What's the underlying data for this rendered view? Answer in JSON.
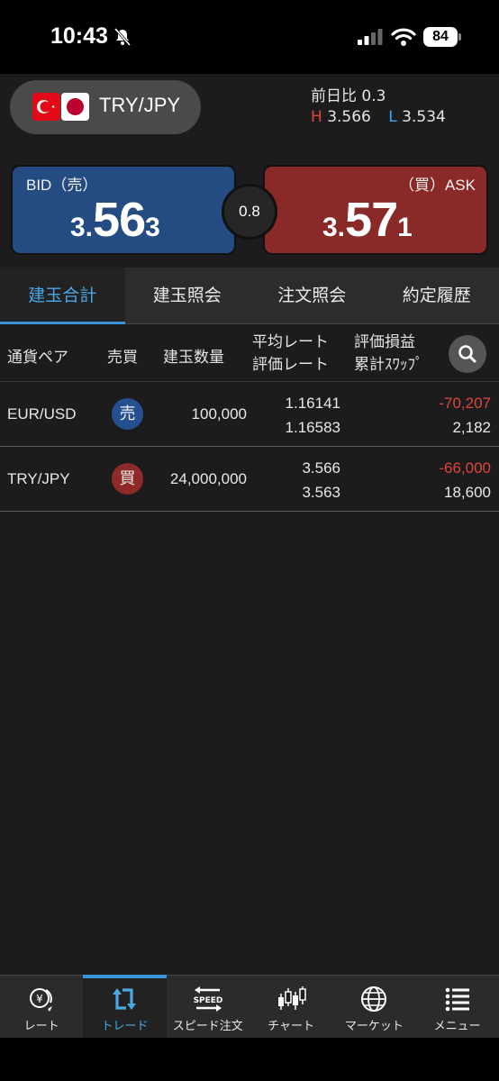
{
  "status_bar": {
    "time": "10:43",
    "battery": "84"
  },
  "header": {
    "pair": "TRY/JPY",
    "prev_day_label": "前日比",
    "prev_day_value": "0.3",
    "high_letter": "H",
    "high_value": "3.566",
    "low_letter": "L",
    "low_value": "3.534"
  },
  "quote": {
    "bid_label": "BID（売）",
    "bid_prefix": "3.",
    "bid_main": "56",
    "bid_suffix": "3",
    "ask_label": "（買）ASK",
    "ask_prefix": "3.",
    "ask_main": "57",
    "ask_suffix": "1",
    "spread": "0.8"
  },
  "tabs": [
    {
      "label": "建玉合計",
      "active": true
    },
    {
      "label": "建玉照会",
      "active": false
    },
    {
      "label": "注文照会",
      "active": false
    },
    {
      "label": "約定履歴",
      "active": false
    }
  ],
  "table": {
    "headers": {
      "pair": "通貨ペア",
      "side": "売買",
      "qty": "建玉数量",
      "avg_rate": "平均レート",
      "eval_rate": "評価レート",
      "pl": "評価損益",
      "swap": "累計ｽﾜｯﾌﾟ"
    },
    "rows": [
      {
        "pair": "EUR/USD",
        "side": "売",
        "qty": "100,000",
        "avg_rate": "1.16141",
        "eval_rate": "1.16583",
        "pl": "-70,207",
        "swap": "2,182"
      },
      {
        "pair": "TRY/JPY",
        "side": "買",
        "qty": "24,000,000",
        "avg_rate": "3.566",
        "eval_rate": "3.563",
        "pl": "-66,000",
        "swap": "18,600"
      }
    ]
  },
  "bottom_nav": [
    {
      "label": "レート",
      "icon": "yen-rate-icon",
      "active": false
    },
    {
      "label": "トレード",
      "icon": "trade-arrows-icon",
      "active": true
    },
    {
      "label": "スピード注文",
      "icon": "speed-order-icon",
      "active": false
    },
    {
      "label": "チャート",
      "icon": "candlestick-icon",
      "active": false
    },
    {
      "label": "マーケット",
      "icon": "globe-icon",
      "active": false
    },
    {
      "label": "メニュー",
      "icon": "menu-list-icon",
      "active": false
    }
  ],
  "colors": {
    "background": "#1c1c1c",
    "bid": "#244c82",
    "ask": "#8a2a28",
    "accent": "#3b94d6",
    "negative": "#e0453c"
  }
}
